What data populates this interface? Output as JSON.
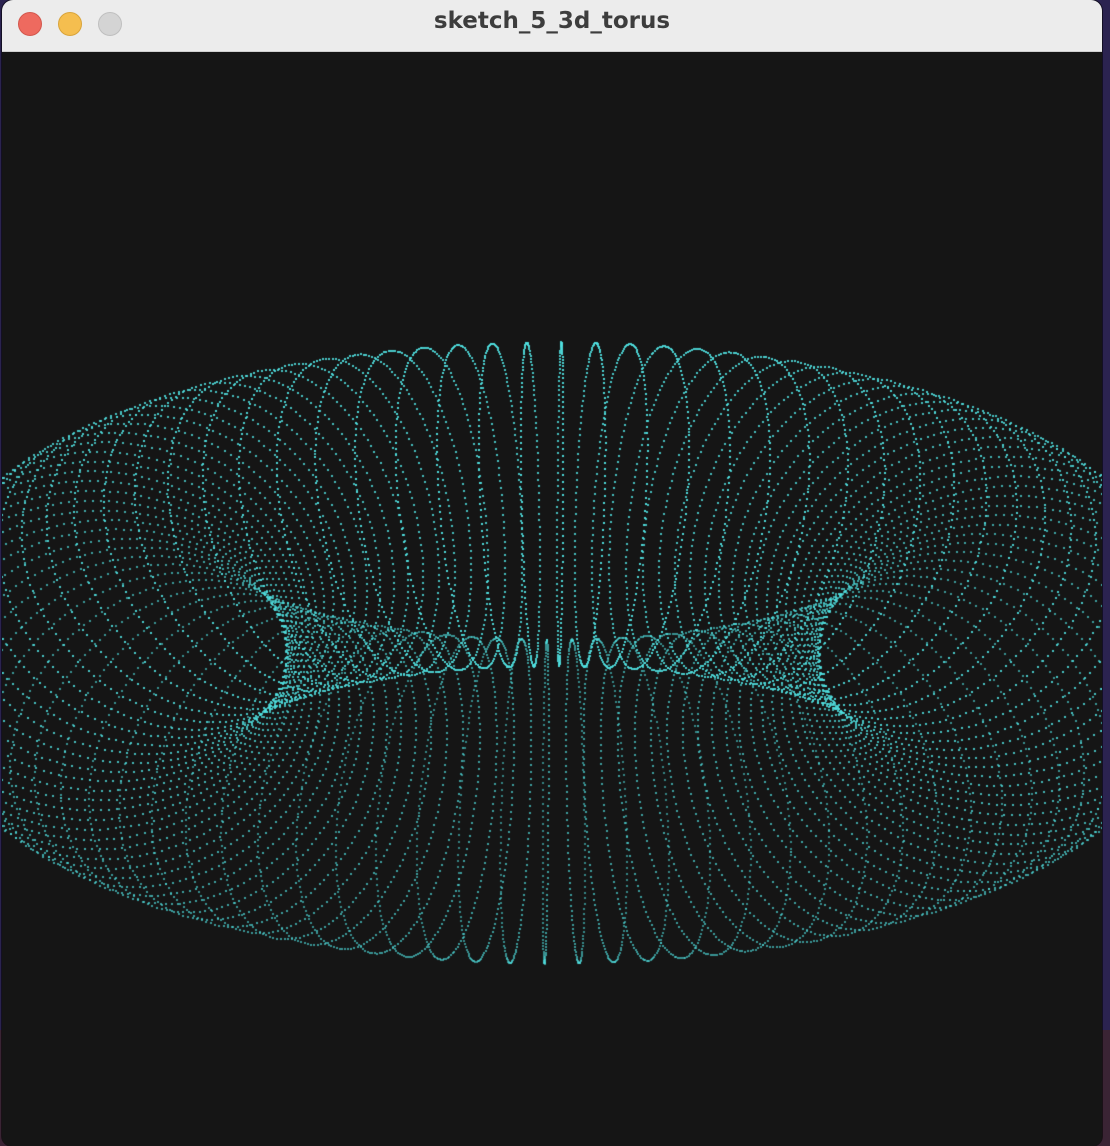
{
  "window": {
    "title": "sketch_5_3d_torus"
  },
  "colors": {
    "desktop": "#2b2350",
    "titlebar": "#ececec",
    "canvas_background": "#151515",
    "point_color": "#4fdede",
    "close": "#ee6a5f",
    "minimize": "#f5be4f",
    "zoom": "#d4d4d4"
  },
  "icons": {
    "close": "close-traffic-light-icon",
    "minimize": "minimize-traffic-light-icon",
    "zoom": "zoom-traffic-light-icon"
  }
}
